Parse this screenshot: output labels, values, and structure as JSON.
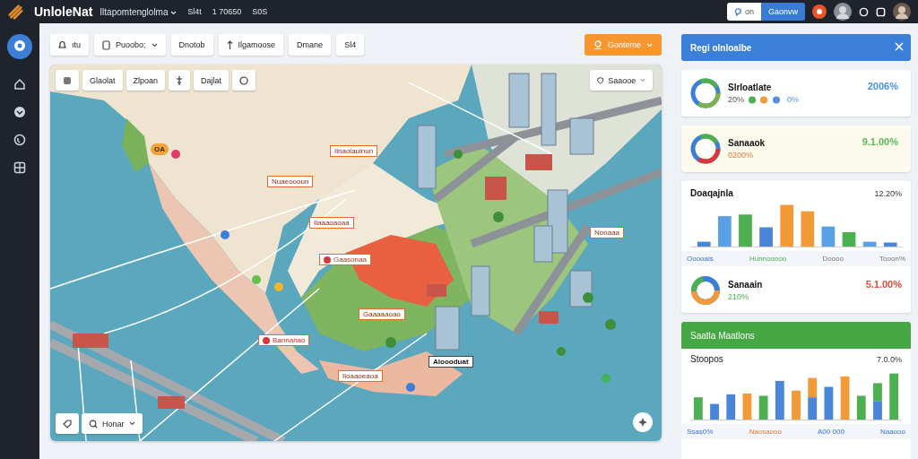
{
  "topbar": {
    "app_name": "UnloleNat",
    "menu": "Iltapomtenglolma",
    "stats": [
      "Sl4t",
      "1 70650",
      "S0S"
    ],
    "toggle": {
      "label": "on"
    },
    "primary_button": "Gaonvw"
  },
  "toolbar": {
    "buttons": [
      {
        "label": "ıtu",
        "kind": "bell",
        "dropdown": false
      },
      {
        "label": "Puoobo:",
        "kind": "doc",
        "dropdown": true
      },
      {
        "label": "Dnotob",
        "kind": "plain",
        "dropdown": false
      },
      {
        "label": "Ilgamoose",
        "kind": "arrow",
        "dropdown": false
      },
      {
        "label": "Dmane",
        "kind": "plain",
        "dropdown": false
      },
      {
        "label": "Sl4",
        "kind": "plain",
        "dropdown": false
      }
    ],
    "action_button": "Gonteme"
  },
  "map": {
    "tools": [
      "Glaolat",
      "Zlpoan",
      "Dajlat"
    ],
    "layer_select": "Saaooe",
    "search": "Honar",
    "badge": "OA",
    "labels": [
      {
        "text": "Ilnaolaulnun",
        "kind": "orange"
      },
      {
        "text": "Nuaeoooun",
        "kind": "orange"
      },
      {
        "text": "Ilaaaoaoaa",
        "kind": "orange"
      },
      {
        "text": "Gaasonaa",
        "kind": "pin"
      },
      {
        "text": "Gaaaaaoao",
        "kind": "orange"
      },
      {
        "text": "Bannanao",
        "kind": "pin"
      },
      {
        "text": "Aloooduat",
        "kind": "plain"
      },
      {
        "text": "Iloaaoeaoa",
        "kind": "orange"
      },
      {
        "text": "Nonaaa",
        "kind": "orange"
      }
    ]
  },
  "panel": {
    "title": "Regi olnloalbe",
    "cards": [
      {
        "kind": "ring",
        "name": "Slrloatlate",
        "sub": "20%",
        "extra": "0%",
        "value": "2006%",
        "color": "#4a90e2",
        "tint": false
      },
      {
        "kind": "ring",
        "name": "Sanaaok",
        "sub": "0200%",
        "value": "9.1.00%",
        "color": "#5cb85c",
        "tint": true
      }
    ],
    "chart_card": {
      "title": "Doaqajnla",
      "value": "12.20%",
      "legend": [
        "Ooooais",
        "Hunnooooo",
        "Doooo",
        "Tooon%"
      ],
      "ring": {
        "name": "Sanaain",
        "sub": "210%",
        "value": "5.1.00%",
        "color": "#e04b3c"
      }
    },
    "section": {
      "title": "Saatla Maatlons",
      "subtitle": "Stoopos",
      "value": "7.0.0%",
      "legend": [
        "Ssas0%",
        "Naosaooo",
        "A00 000",
        "Naaooo"
      ]
    }
  }
}
